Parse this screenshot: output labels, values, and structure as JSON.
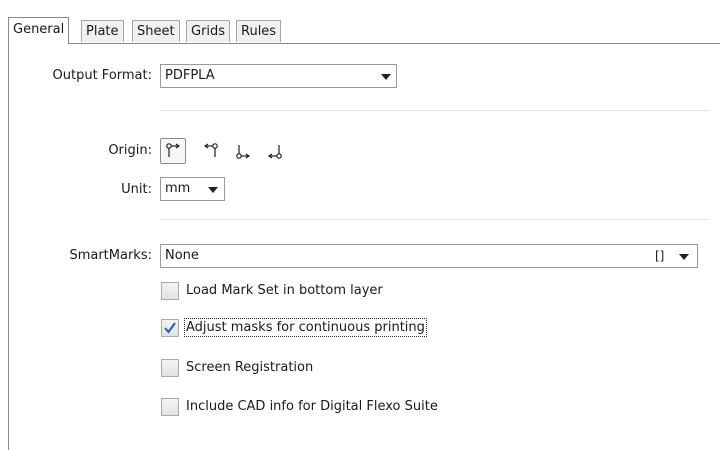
{
  "tabs": [
    {
      "label": "General",
      "active": true
    },
    {
      "label": "Plate",
      "active": false
    },
    {
      "label": "Sheet",
      "active": false
    },
    {
      "label": "Grids",
      "active": false
    },
    {
      "label": "Rules",
      "active": false
    }
  ],
  "output_format": {
    "label": "Output Format:",
    "value": "PDFPLA"
  },
  "origin": {
    "label": "Origin:",
    "options": [
      {
        "icon": "origin-top-left-icon",
        "selected": true
      },
      {
        "icon": "origin-top-right-icon",
        "selected": false
      },
      {
        "icon": "origin-bottom-left-icon",
        "selected": false
      },
      {
        "icon": "origin-bottom-right-icon",
        "selected": false
      }
    ]
  },
  "unit": {
    "label": "Unit:",
    "value": "mm"
  },
  "smartmarks": {
    "label": "SmartMarks:",
    "value": "None",
    "browse_label": "[]"
  },
  "options": [
    {
      "label": "Load Mark Set in bottom layer",
      "checked": false
    },
    {
      "label": "Adjust masks for continuous printing",
      "checked": true
    },
    {
      "label": "Screen Registration",
      "checked": false
    },
    {
      "label": "Include CAD info for Digital Flexo Suite",
      "checked": false
    }
  ],
  "colors": {
    "check": "#1f5fbf",
    "border": "#8a8a8a"
  }
}
